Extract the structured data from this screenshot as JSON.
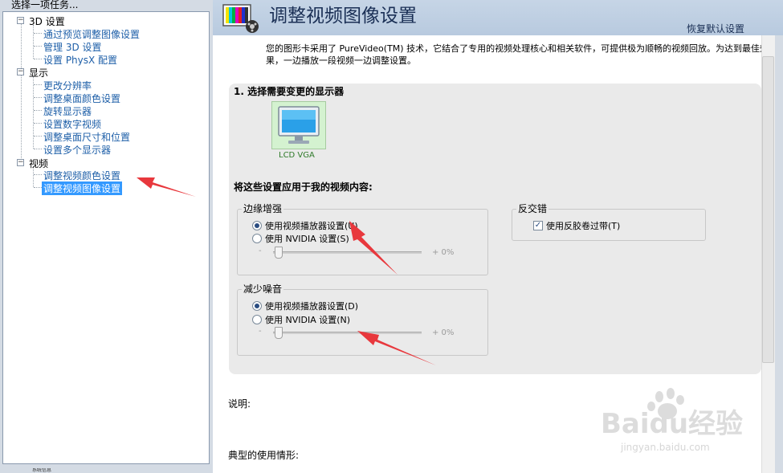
{
  "sidebar": {
    "task_label": "选择一项任务...",
    "categories": [
      {
        "label": "3D 设置",
        "items": [
          "通过预览调整图像设置",
          "管理 3D 设置",
          "设置 PhysX 配置"
        ]
      },
      {
        "label": "显示",
        "items": [
          "更改分辨率",
          "调整桌面颜色设置",
          "旋转显示器",
          "设置数字视频",
          "调整桌面尺寸和位置",
          "设置多个显示器"
        ]
      },
      {
        "label": "视频",
        "items": [
          "调整视频颜色设置",
          "调整视频图像设置"
        ]
      }
    ],
    "selected_item": "调整视频图像设置",
    "bottom_text": "系统信息"
  },
  "header": {
    "title": "调整视频图像设置",
    "restore_defaults": "恢复默认设置"
  },
  "main": {
    "description": "您的图形卡采用了 PureVideo(TM) 技术，它结合了专用的视频处理核心和相关软件，可提供极为顺畅的视频回放。为达到最佳效果，一边播放一段视频一边调整设置。",
    "section1_title": "1. 选择需要变更的显示器",
    "monitor_label": "LCD VGA",
    "apply_title": "将这些设置应用于我的视频内容:",
    "edge_enhancement": {
      "title": "边缘增强",
      "option_player": "使用视频播放器设置(U)",
      "option_nvidia": "使用 NVIDIA 设置(S)",
      "selected": "player",
      "slider_minus": "-",
      "slider_value": "+ 0%",
      "slider_level_percent": 0
    },
    "noise_reduction": {
      "title": "减少噪音",
      "option_player": "使用视频播放器设置(D)",
      "option_nvidia": "使用 NVIDIA 设置(N)",
      "selected": "player",
      "slider_minus": "-",
      "slider_value": "+ 0%",
      "slider_level_percent": 0
    },
    "deinterlacing": {
      "title": "反交错",
      "checkbox_label": "使用反胶卷过带(T)",
      "checked": true
    },
    "note_label": "说明:",
    "usage_label": "典型的使用情形:"
  },
  "watermark": {
    "brand": "Baidu经验",
    "url": "jingyan.baidu.com"
  },
  "colors": {
    "selection": "#3399ff",
    "link": "#1e5fa8",
    "annotation_arrow": "#e8383d",
    "monitor_green": "#d4f2d0"
  }
}
